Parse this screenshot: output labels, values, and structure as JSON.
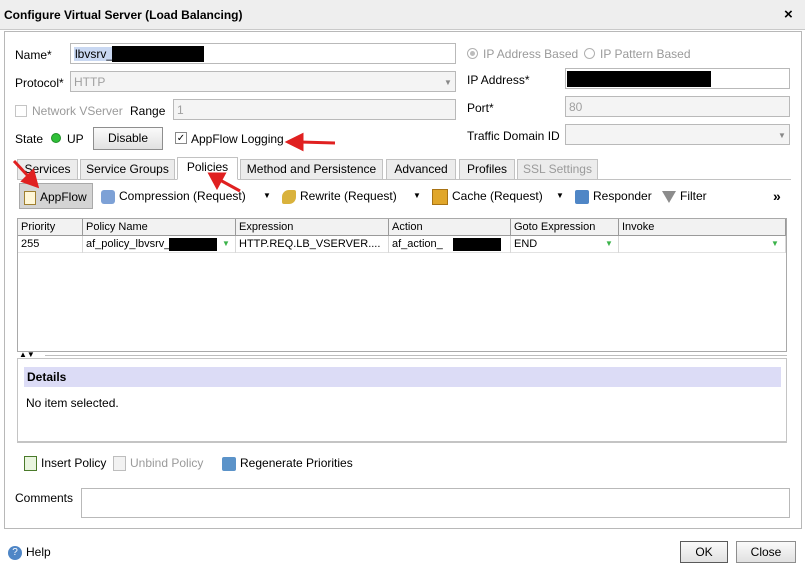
{
  "window": {
    "title": "Configure Virtual Server (Load Balancing)",
    "close_glyph": "×"
  },
  "form": {
    "name_label": "Name*",
    "name_value": "lbvsrv_",
    "protocol_label": "Protocol*",
    "protocol_value": "HTTP",
    "network_vserver_label": "Network VServer",
    "range_label": "Range",
    "range_value": "1",
    "state_label": "State",
    "state_value": "UP",
    "disable_button": "Disable",
    "appflow_logging_label": "AppFlow Logging",
    "ip_address_based_label": "IP Address Based",
    "ip_pattern_based_label": "IP Pattern Based",
    "ip_address_label": "IP Address*",
    "port_label": "Port*",
    "port_value": "80",
    "traffic_domain_label": "Traffic Domain ID"
  },
  "tabs": [
    {
      "label": "Services"
    },
    {
      "label": "Service Groups"
    },
    {
      "label": "Policies"
    },
    {
      "label": "Method and Persistence"
    },
    {
      "label": "Advanced"
    },
    {
      "label": "Profiles"
    },
    {
      "label": "SSL Settings"
    }
  ],
  "toolbar": {
    "appflow": "AppFlow",
    "compression": "Compression (Request)",
    "rewrite": "Rewrite (Request)",
    "cache": "Cache (Request)",
    "responder": "Responder",
    "filter": "Filter",
    "more": "»"
  },
  "grid": {
    "columns": [
      "Priority",
      "Policy Name",
      "Expression",
      "Action",
      "Goto Expression",
      "Invoke"
    ],
    "rows": [
      {
        "priority": "255",
        "policy_name": "af_policy_lbvsrv_",
        "expression": "HTTP.REQ.LB_VSERVER....",
        "action": "af_action_",
        "goto": "END",
        "invoke": ""
      }
    ]
  },
  "details": {
    "title": "Details",
    "empty_text": "No item selected."
  },
  "actions": {
    "insert_policy": "Insert Policy",
    "unbind_policy": "Unbind Policy",
    "regenerate_priorities": "Regenerate Priorities"
  },
  "comments_label": "Comments",
  "footer": {
    "help": "Help",
    "ok": "OK",
    "close": "Close"
  },
  "colors": {
    "annotation_arrow": "#e02020",
    "state_up": "#2fbf38",
    "details_header": "#dcdcf6"
  }
}
